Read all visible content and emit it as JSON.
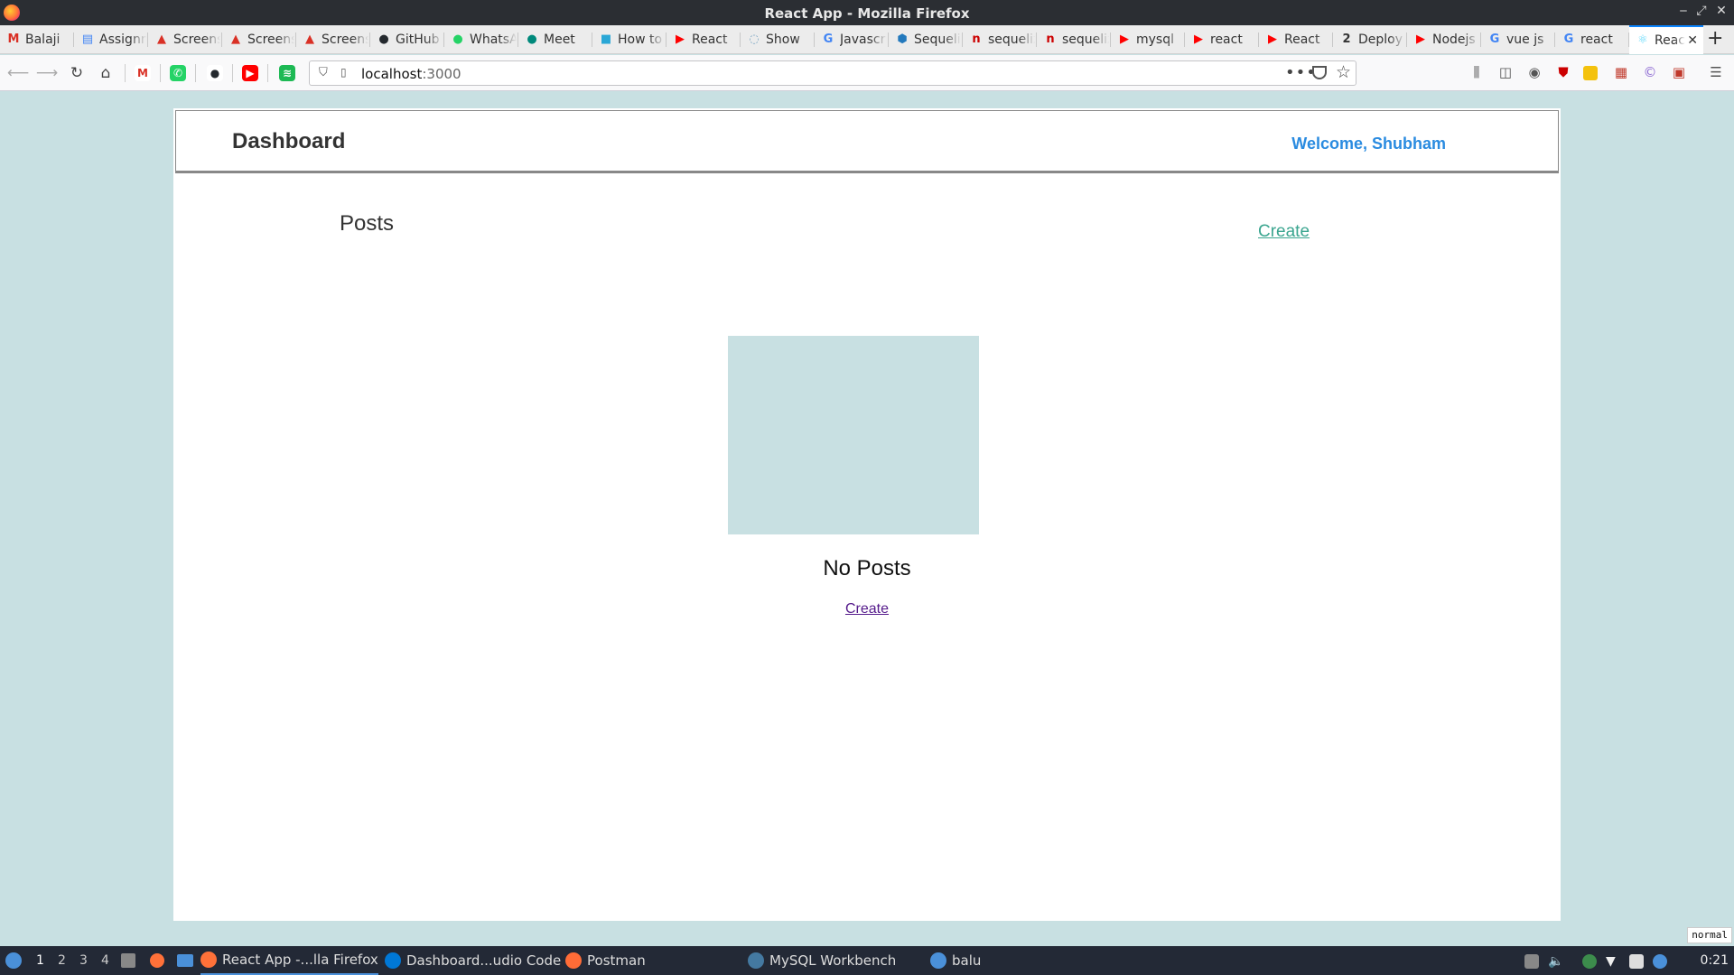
{
  "window": {
    "title": "React App - Mozilla Firefox",
    "minimize": "‒",
    "maximize": "⤢",
    "close": "✕"
  },
  "tabs": [
    {
      "label": "Balaji",
      "color": "#d93025",
      "glyph": "M"
    },
    {
      "label": "Assignment",
      "color": "#4285f4",
      "glyph": "▤"
    },
    {
      "label": "Screenshot",
      "color": "#d93025",
      "glyph": "▲"
    },
    {
      "label": "Screenshot",
      "color": "#d93025",
      "glyph": "▲"
    },
    {
      "label": "Screenshot",
      "color": "#d93025",
      "glyph": "▲"
    },
    {
      "label": "GitHub",
      "color": "#24292e",
      "glyph": "●"
    },
    {
      "label": "WhatsApp",
      "color": "#25d366",
      "glyph": "●"
    },
    {
      "label": "Meet",
      "color": "#00897b",
      "glyph": "●"
    },
    {
      "label": "How to",
      "color": "#2aa7d6",
      "glyph": "■"
    },
    {
      "label": "React",
      "color": "#ff0000",
      "glyph": "▶"
    },
    {
      "label": "Show",
      "color": "#7aa6c2",
      "glyph": "◌"
    },
    {
      "label": "Javascript",
      "color": "#4285f4",
      "glyph": "G"
    },
    {
      "label": "Sequelize",
      "color": "#2379bd",
      "glyph": "⬢"
    },
    {
      "label": "sequelize",
      "color": "#cc0000",
      "glyph": "n"
    },
    {
      "label": "sequelize",
      "color": "#cc0000",
      "glyph": "n"
    },
    {
      "label": "mysql",
      "color": "#ff0000",
      "glyph": "▶"
    },
    {
      "label": "react",
      "color": "#ff0000",
      "glyph": "▶"
    },
    {
      "label": "React",
      "color": "#ff0000",
      "glyph": "▶"
    },
    {
      "label": "Deploy",
      "color": "#333333",
      "glyph": "2"
    },
    {
      "label": "Nodejs",
      "color": "#ff0000",
      "glyph": "▶"
    },
    {
      "label": "vue js",
      "color": "#4285f4",
      "glyph": "G"
    },
    {
      "label": "react",
      "color": "#4285f4",
      "glyph": "G"
    },
    {
      "label": "React",
      "color": "#61dafb",
      "glyph": "⚛"
    }
  ],
  "new_tab": "+",
  "active_tab_close": "✕",
  "nav": {
    "url_host": "localhost",
    "url_port": ":3000",
    "more": "•••"
  },
  "bookmarks": [
    {
      "name": "gmail-bookmark",
      "glyph": "M",
      "color": "#ffffff",
      "fg": "#d93025"
    },
    {
      "name": "whatsapp-bookmark",
      "glyph": "✆",
      "color": "#25d366",
      "fg": "#ffffff"
    },
    {
      "name": "github-bookmark",
      "glyph": "●",
      "color": "#ffffff",
      "fg": "#24292e"
    },
    {
      "name": "youtube-bookmark",
      "glyph": "▶",
      "color": "#ff0000",
      "fg": "#ffffff"
    },
    {
      "name": "spotify-bookmark",
      "glyph": "≋",
      "color": "#1db954",
      "fg": "#ffffff"
    }
  ],
  "page": {
    "header_title": "Dashboard",
    "welcome": "Welcome, Shubham",
    "posts_title": "Posts",
    "create_link_top": "Create",
    "empty_message": "No Posts",
    "create_link_bottom": "Create"
  },
  "mode_badge": "normal",
  "taskbar": {
    "workspaces": [
      "1",
      "2",
      "3",
      "4"
    ],
    "apps": [
      {
        "label": "React App -...lla Firefox",
        "color": "#ff7139"
      },
      {
        "label": "Dashboard...udio Code",
        "color": "#0078d7"
      },
      {
        "label": "Postman",
        "color": "#ff6c37"
      },
      {
        "label": "MySQL Workbench",
        "color": "#4479a1"
      },
      {
        "label": "balu",
        "color": "#4a90d9"
      }
    ],
    "clock": "0:21"
  },
  "colors": {
    "page_bg": "#c8e0e2",
    "welcome": "#2a8be0",
    "create_top": "#3aa58f",
    "create_bottom": "#551a8b",
    "active_tab_accent": "#0a84ff"
  }
}
